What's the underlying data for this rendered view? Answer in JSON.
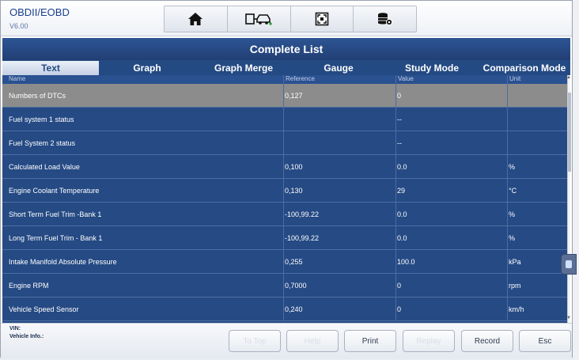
{
  "header": {
    "app_title": "OBDII/EOBD",
    "version": "V6.00",
    "toolbar": [
      {
        "icon": "home-icon"
      },
      {
        "icon": "vehicle-connect-icon"
      },
      {
        "icon": "screenshot-icon"
      },
      {
        "icon": "database-settings-icon"
      }
    ]
  },
  "panel": {
    "title": "Complete List",
    "tabs": [
      {
        "label": "Text",
        "active": true
      },
      {
        "label": "Graph",
        "active": false
      },
      {
        "label": "Graph Merge",
        "active": false
      },
      {
        "label": "Gauge",
        "active": false
      },
      {
        "label": "Study Mode",
        "active": false
      },
      {
        "label": "Comparison Mode",
        "active": false
      }
    ],
    "columns": {
      "name": "Name",
      "reference": "Reference",
      "value": "Value",
      "unit": "Unit"
    },
    "rows": [
      {
        "name": "Numbers of DTCs",
        "reference": "0,127",
        "value": "0",
        "unit": "",
        "selected": true
      },
      {
        "name": "Fuel system 1 status",
        "reference": "",
        "value": "--",
        "unit": "",
        "selected": false
      },
      {
        "name": "Fuel System 2 status",
        "reference": "",
        "value": "--",
        "unit": "",
        "selected": false
      },
      {
        "name": "Calculated Load Value",
        "reference": "0,100",
        "value": "0.0",
        "unit": "%",
        "selected": false
      },
      {
        "name": "Engine Coolant Temperature",
        "reference": "0,130",
        "value": "29",
        "unit": "°C",
        "selected": false
      },
      {
        "name": "Short Term Fuel Trim -Bank 1",
        "reference": "-100,99.22",
        "value": "0.0",
        "unit": "%",
        "selected": false
      },
      {
        "name": "Long Term Fuel Trim - Bank 1",
        "reference": "-100,99.22",
        "value": "0.0",
        "unit": "%",
        "selected": false
      },
      {
        "name": "Intake Manifold Absolute Pressure",
        "reference": "0,255",
        "value": "100.0",
        "unit": "kPa",
        "selected": false
      },
      {
        "name": "Engine RPM",
        "reference": "0,7000",
        "value": "0",
        "unit": "rpm",
        "selected": false
      },
      {
        "name": "Vehicle Speed Sensor",
        "reference": "0,240",
        "value": "0",
        "unit": "km/h",
        "selected": false
      }
    ]
  },
  "footer": {
    "vin_label": "VIN:",
    "vehicle_info_label": "Vehicle Info.:",
    "buttons": [
      {
        "label": "To Top",
        "enabled": false
      },
      {
        "label": "Help",
        "enabled": false
      },
      {
        "label": "Print",
        "enabled": true
      },
      {
        "label": "Replay",
        "enabled": false
      },
      {
        "label": "Record",
        "enabled": true
      },
      {
        "label": "Esc",
        "enabled": true
      }
    ]
  },
  "colors": {
    "panel_bg": "#254a84",
    "selected_row": "#8c8c8c",
    "title_text": "#1a3f8f"
  }
}
